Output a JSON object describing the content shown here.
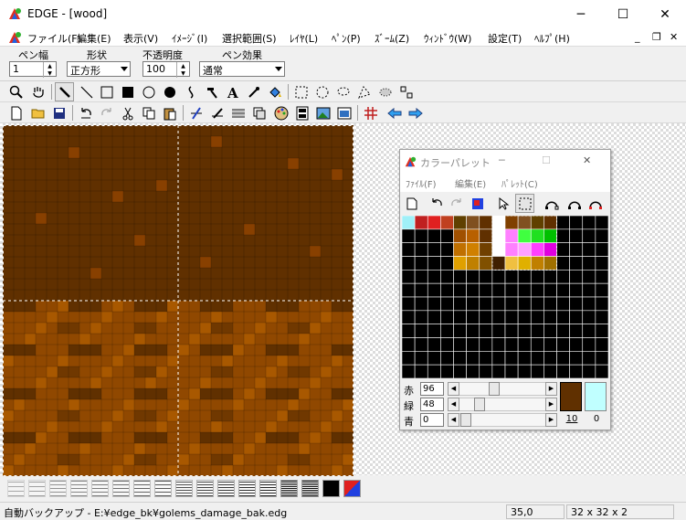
{
  "window": {
    "title": "EDGE - [wood]",
    "minimize": "─",
    "maximize": "☐",
    "close": "✕",
    "mdi_minimize": "_",
    "mdi_restore": "❐",
    "mdi_close": "✕"
  },
  "menu": [
    "ファイル(F)",
    "編集(E)",
    "表示(V)",
    "ｲﾒｰｼﾞ(I)",
    "選択範囲(S)",
    "ﾚｲﾔ(L)",
    "ﾍﾟﾝ(P)",
    "ｽﾞｰﾑ(Z)",
    "ｳｨﾝﾄﾞｳ(W)",
    "設定(T)",
    "ﾍﾙﾌﾟ(H)"
  ],
  "options": {
    "pen_width": {
      "label": "ペン幅",
      "value": "1"
    },
    "shape": {
      "label": "形状",
      "value": "正方形"
    },
    "opacity": {
      "label": "不透明度",
      "value": "100"
    },
    "pen_effect": {
      "label": "ペン効果",
      "value": "通常"
    }
  },
  "palette_window": {
    "title": "カラーパレット",
    "minimize": "─",
    "maximize": "☐",
    "close": "✕",
    "menu": [
      "ﾌｧｲﾙ(F)",
      "編集(E)",
      "ﾊﾟﾚｯﾄ(C)"
    ],
    "sliders": [
      {
        "label": "赤",
        "value": "96"
      },
      {
        "label": "緑",
        "value": "48"
      },
      {
        "label": "青",
        "value": "0"
      }
    ],
    "index_label": "10",
    "index_value": "0",
    "current_color": "#603000",
    "background_color": "#c0ffff"
  },
  "status": {
    "message": "自動バックアップ - E:¥edge_bk¥golems_damage_bak.edg",
    "coords": "35,0",
    "size": "32 x 32 x 2"
  },
  "colors": {
    "wood_dark": "#603000",
    "wood_mid": "#904800",
    "wood_light": "#a85800"
  }
}
